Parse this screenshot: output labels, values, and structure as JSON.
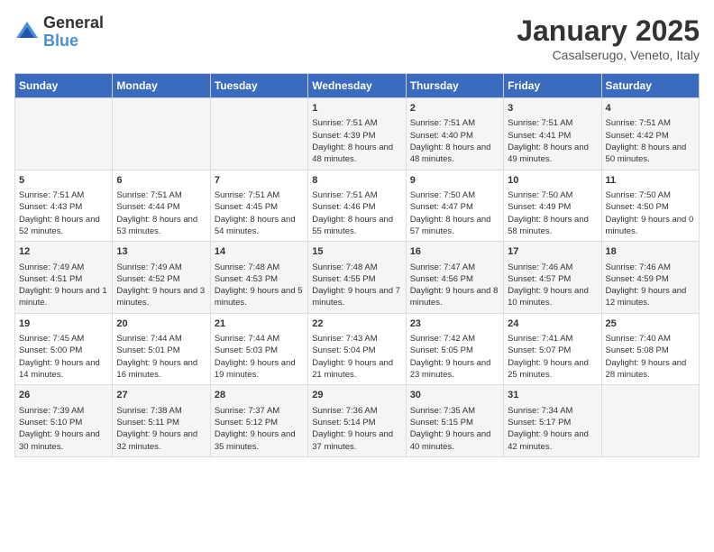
{
  "header": {
    "logo_general": "General",
    "logo_blue": "Blue",
    "title": "January 2025",
    "subtitle": "Casalserugo, Veneto, Italy"
  },
  "weekdays": [
    "Sunday",
    "Monday",
    "Tuesday",
    "Wednesday",
    "Thursday",
    "Friday",
    "Saturday"
  ],
  "weeks": [
    [
      {
        "day": "",
        "content": ""
      },
      {
        "day": "",
        "content": ""
      },
      {
        "day": "",
        "content": ""
      },
      {
        "day": "1",
        "content": "Sunrise: 7:51 AM\nSunset: 4:39 PM\nDaylight: 8 hours and 48 minutes."
      },
      {
        "day": "2",
        "content": "Sunrise: 7:51 AM\nSunset: 4:40 PM\nDaylight: 8 hours and 48 minutes."
      },
      {
        "day": "3",
        "content": "Sunrise: 7:51 AM\nSunset: 4:41 PM\nDaylight: 8 hours and 49 minutes."
      },
      {
        "day": "4",
        "content": "Sunrise: 7:51 AM\nSunset: 4:42 PM\nDaylight: 8 hours and 50 minutes."
      }
    ],
    [
      {
        "day": "5",
        "content": "Sunrise: 7:51 AM\nSunset: 4:43 PM\nDaylight: 8 hours and 52 minutes."
      },
      {
        "day": "6",
        "content": "Sunrise: 7:51 AM\nSunset: 4:44 PM\nDaylight: 8 hours and 53 minutes."
      },
      {
        "day": "7",
        "content": "Sunrise: 7:51 AM\nSunset: 4:45 PM\nDaylight: 8 hours and 54 minutes."
      },
      {
        "day": "8",
        "content": "Sunrise: 7:51 AM\nSunset: 4:46 PM\nDaylight: 8 hours and 55 minutes."
      },
      {
        "day": "9",
        "content": "Sunrise: 7:50 AM\nSunset: 4:47 PM\nDaylight: 8 hours and 57 minutes."
      },
      {
        "day": "10",
        "content": "Sunrise: 7:50 AM\nSunset: 4:49 PM\nDaylight: 8 hours and 58 minutes."
      },
      {
        "day": "11",
        "content": "Sunrise: 7:50 AM\nSunset: 4:50 PM\nDaylight: 9 hours and 0 minutes."
      }
    ],
    [
      {
        "day": "12",
        "content": "Sunrise: 7:49 AM\nSunset: 4:51 PM\nDaylight: 9 hours and 1 minute."
      },
      {
        "day": "13",
        "content": "Sunrise: 7:49 AM\nSunset: 4:52 PM\nDaylight: 9 hours and 3 minutes."
      },
      {
        "day": "14",
        "content": "Sunrise: 7:48 AM\nSunset: 4:53 PM\nDaylight: 9 hours and 5 minutes."
      },
      {
        "day": "15",
        "content": "Sunrise: 7:48 AM\nSunset: 4:55 PM\nDaylight: 9 hours and 7 minutes."
      },
      {
        "day": "16",
        "content": "Sunrise: 7:47 AM\nSunset: 4:56 PM\nDaylight: 9 hours and 8 minutes."
      },
      {
        "day": "17",
        "content": "Sunrise: 7:46 AM\nSunset: 4:57 PM\nDaylight: 9 hours and 10 minutes."
      },
      {
        "day": "18",
        "content": "Sunrise: 7:46 AM\nSunset: 4:59 PM\nDaylight: 9 hours and 12 minutes."
      }
    ],
    [
      {
        "day": "19",
        "content": "Sunrise: 7:45 AM\nSunset: 5:00 PM\nDaylight: 9 hours and 14 minutes."
      },
      {
        "day": "20",
        "content": "Sunrise: 7:44 AM\nSunset: 5:01 PM\nDaylight: 9 hours and 16 minutes."
      },
      {
        "day": "21",
        "content": "Sunrise: 7:44 AM\nSunset: 5:03 PM\nDaylight: 9 hours and 19 minutes."
      },
      {
        "day": "22",
        "content": "Sunrise: 7:43 AM\nSunset: 5:04 PM\nDaylight: 9 hours and 21 minutes."
      },
      {
        "day": "23",
        "content": "Sunrise: 7:42 AM\nSunset: 5:05 PM\nDaylight: 9 hours and 23 minutes."
      },
      {
        "day": "24",
        "content": "Sunrise: 7:41 AM\nSunset: 5:07 PM\nDaylight: 9 hours and 25 minutes."
      },
      {
        "day": "25",
        "content": "Sunrise: 7:40 AM\nSunset: 5:08 PM\nDaylight: 9 hours and 28 minutes."
      }
    ],
    [
      {
        "day": "26",
        "content": "Sunrise: 7:39 AM\nSunset: 5:10 PM\nDaylight: 9 hours and 30 minutes."
      },
      {
        "day": "27",
        "content": "Sunrise: 7:38 AM\nSunset: 5:11 PM\nDaylight: 9 hours and 32 minutes."
      },
      {
        "day": "28",
        "content": "Sunrise: 7:37 AM\nSunset: 5:12 PM\nDaylight: 9 hours and 35 minutes."
      },
      {
        "day": "29",
        "content": "Sunrise: 7:36 AM\nSunset: 5:14 PM\nDaylight: 9 hours and 37 minutes."
      },
      {
        "day": "30",
        "content": "Sunrise: 7:35 AM\nSunset: 5:15 PM\nDaylight: 9 hours and 40 minutes."
      },
      {
        "day": "31",
        "content": "Sunrise: 7:34 AM\nSunset: 5:17 PM\nDaylight: 9 hours and 42 minutes."
      },
      {
        "day": "",
        "content": ""
      }
    ]
  ]
}
